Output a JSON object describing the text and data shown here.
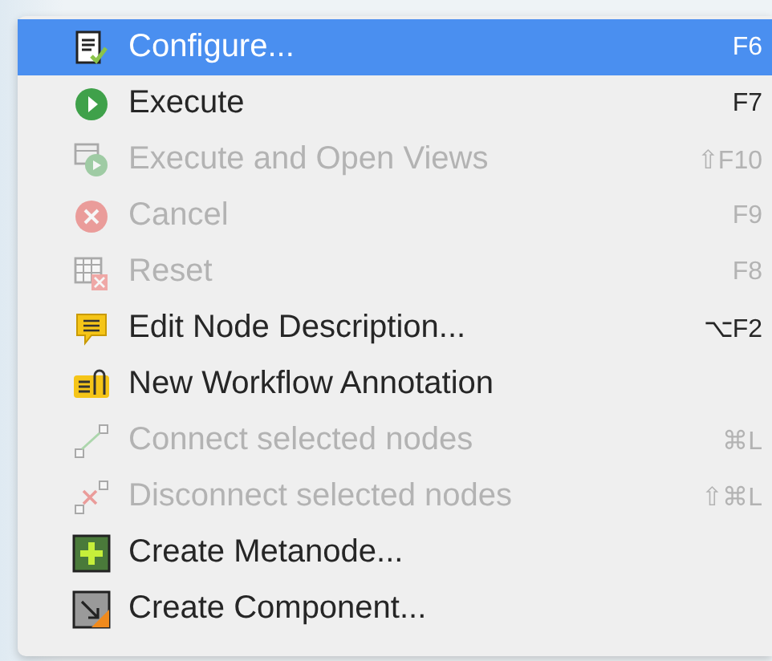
{
  "menu": {
    "items": [
      {
        "kind": "configure",
        "label": "Configure...",
        "shortcut": "F6",
        "selected": true,
        "disabled": false
      },
      {
        "kind": "execute",
        "label": "Execute",
        "shortcut": "F7",
        "selected": false,
        "disabled": false
      },
      {
        "kind": "views",
        "label": "Execute and Open Views",
        "shortcut": "⇧F10",
        "selected": false,
        "disabled": true
      },
      {
        "kind": "cancel",
        "label": "Cancel",
        "shortcut": "F9",
        "selected": false,
        "disabled": true
      },
      {
        "kind": "reset",
        "label": "Reset",
        "shortcut": "F8",
        "selected": false,
        "disabled": true
      },
      {
        "kind": "description",
        "label": "Edit Node Description...",
        "shortcut": "⌥F2",
        "selected": false,
        "disabled": false
      },
      {
        "kind": "annotation",
        "label": "New Workflow Annotation",
        "selected": false,
        "disabled": false
      },
      {
        "kind": "connect",
        "label": "Connect selected nodes",
        "shortcut": "⌘L",
        "selected": false,
        "disabled": true
      },
      {
        "kind": "disconnect",
        "label": "Disconnect selected nodes",
        "shortcut": "⇧⌘L",
        "selected": false,
        "disabled": true
      },
      {
        "kind": "metanode",
        "label": "Create Metanode...",
        "selected": false,
        "disabled": false
      },
      {
        "kind": "component",
        "label": "Create Component...",
        "selected": false,
        "disabled": false
      }
    ]
  }
}
